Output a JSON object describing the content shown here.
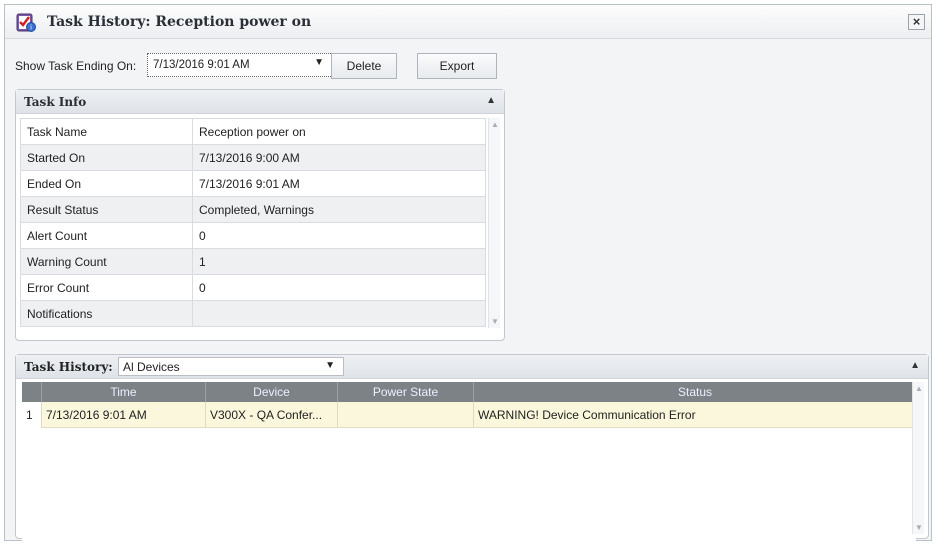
{
  "window": {
    "title": "Task History: Reception power on",
    "close_label": "×",
    "icon": "task-checklist-icon"
  },
  "toolbar": {
    "show_label": "Show Task Ending On:",
    "date_value": "7/13/2016 9:01 AM",
    "delete_label": "Delete",
    "export_label": "Export"
  },
  "task_info": {
    "header": "Task Info",
    "rows": [
      {
        "key": "Task Name",
        "value": "Reception power on"
      },
      {
        "key": "Started On",
        "value": "7/13/2016 9:00 AM"
      },
      {
        "key": "Ended On",
        "value": "7/13/2016 9:01 AM"
      },
      {
        "key": "Result Status",
        "value": "Completed, Warnings"
      },
      {
        "key": "Alert Count",
        "value": "0"
      },
      {
        "key": "Warning Count",
        "value": "1"
      },
      {
        "key": "Error Count",
        "value": "0"
      },
      {
        "key": "Notifications",
        "value": ""
      }
    ]
  },
  "task_history": {
    "label": "Task History:",
    "filter_value": "Al Devices",
    "columns": [
      "Time",
      "Device",
      "Power State",
      "Status"
    ],
    "rows": [
      {
        "index": "1",
        "time": "7/13/2016 9:01 AM",
        "device": "V300X - QA Confer...",
        "power_state": "",
        "status": "WARNING! Device Communication Error"
      }
    ]
  }
}
